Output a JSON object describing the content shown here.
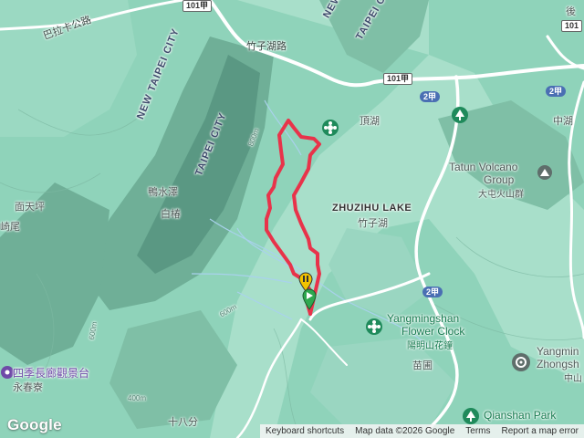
{
  "map": {
    "colors": {
      "land": "#8fd3ba",
      "valley": "#b3e4d2",
      "ridge": "#5f9f88",
      "road": "#ffffff",
      "river": "#9fc9e8",
      "route": "#e8334a",
      "hwy_shield_blue": "#4a6fb3"
    },
    "labels": {
      "road_bala": "巴拉卡公路",
      "road_zhuzihu": "竹子湖路",
      "city_ntpc_1": "NEW TAIPEI CITY",
      "city_taipei_1": "TAIPEI CITY",
      "city_taipei_2": "TAIPEI CITY",
      "city_new_2": "NEW",
      "village_yashuize": "鴨水澤",
      "village_baichun": "白椿",
      "village_miantianping": "面天坪",
      "village_qiwei": "崎尾",
      "village_dinghu": "頂湖",
      "village_zhongtu": "中湖",
      "village_hou": "後",
      "lake_en": "ZHUZIHU LAKE",
      "lake_zh": "竹子湖",
      "poi_tatun_en_1": "Tatun Volcano",
      "poi_tatun_en_2": "Group",
      "poi_tatun_zh": "大屯火山群",
      "poi_flower_en_1": "Yangmingshan",
      "poi_flower_en_2": "Flower Clock",
      "poi_flower_zh": "陽明山花鐘",
      "poi_miaopu": "苗圃",
      "poi_zhongshan_en_1": "Yangmin",
      "poi_zhongshan_en_2": "Zhongsh",
      "poi_zhongshan_zh": "中山",
      "poi_siji_zh": "四季長廊觀景台",
      "poi_yongchun": "永春寮",
      "poi_qianshan": "Qianshan Park",
      "poi_shibafen": "十八分",
      "hwy_101a": "101甲",
      "hwy_101": "101",
      "hwy_2a_1": "2甲",
      "hwy_2a_2": "2甲",
      "hwy_2a_3": "2甲",
      "elev_800": "800m",
      "elev_600a": "600m",
      "elev_600b": "600m",
      "elev_400": "400m"
    },
    "attribution": {
      "keyboard": "Keyboard shortcuts",
      "mapdata": "Map data ©2026 Google",
      "terms": "Terms",
      "report": "Report a map error"
    },
    "google_logo": "Google"
  }
}
